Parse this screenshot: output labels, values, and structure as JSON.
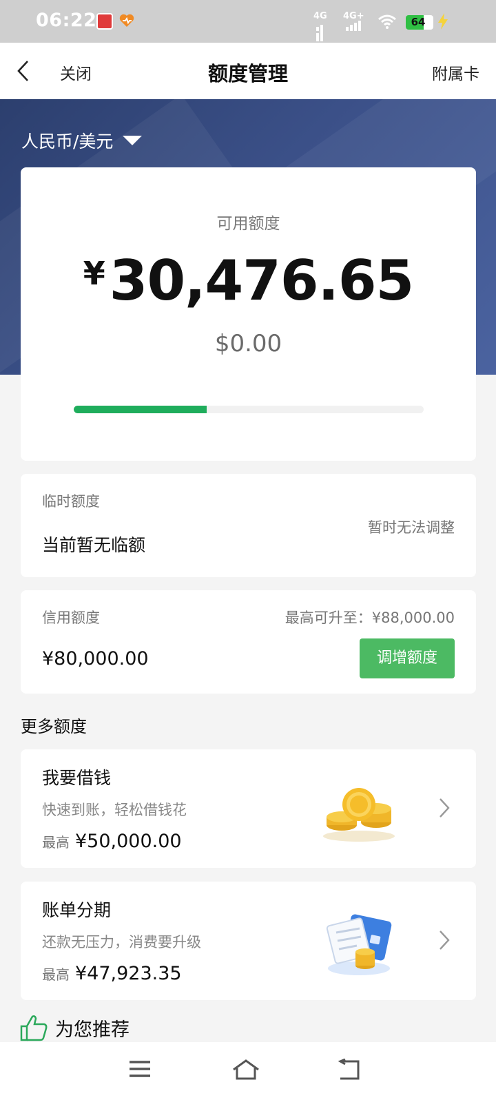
{
  "status_bar": {
    "time": "06:22",
    "signal1": "4G",
    "signal2": "4G+",
    "battery": "64",
    "battery_level": 0.64
  },
  "nav": {
    "close_label": "关闭",
    "title": "额度管理",
    "right_label": "附属卡"
  },
  "currency_selector": "人民币/美元",
  "available": {
    "label": "可用额度",
    "symbol": "¥",
    "amount": "30,476.65",
    "usd": "$0.00",
    "progress_fraction": 0.38
  },
  "temporary": {
    "label": "临时额度",
    "status": "暂时无法调整",
    "value": "当前暂无临额"
  },
  "credit": {
    "label": "信用额度",
    "max_text": "最高可升至：¥88,000.00",
    "value": "¥80,000.00",
    "button": "调增额度"
  },
  "more_title": "更多额度",
  "products": [
    {
      "title": "我要借钱",
      "subtitle": "快速到账，轻松借钱花",
      "max_label": "最高",
      "max_value": "¥50,000.00",
      "icon": "gold-coins-icon"
    },
    {
      "title": "账单分期",
      "subtitle": "还款无压力，消费要升级",
      "max_label": "最高",
      "max_value": "¥47,923.35",
      "icon": "bill-card-coins-icon"
    }
  ],
  "recommend_title": "为您推荐",
  "colors": {
    "hero": "#3b5088",
    "accent_green": "#4cba63",
    "progress_green": "#1fad5c"
  }
}
